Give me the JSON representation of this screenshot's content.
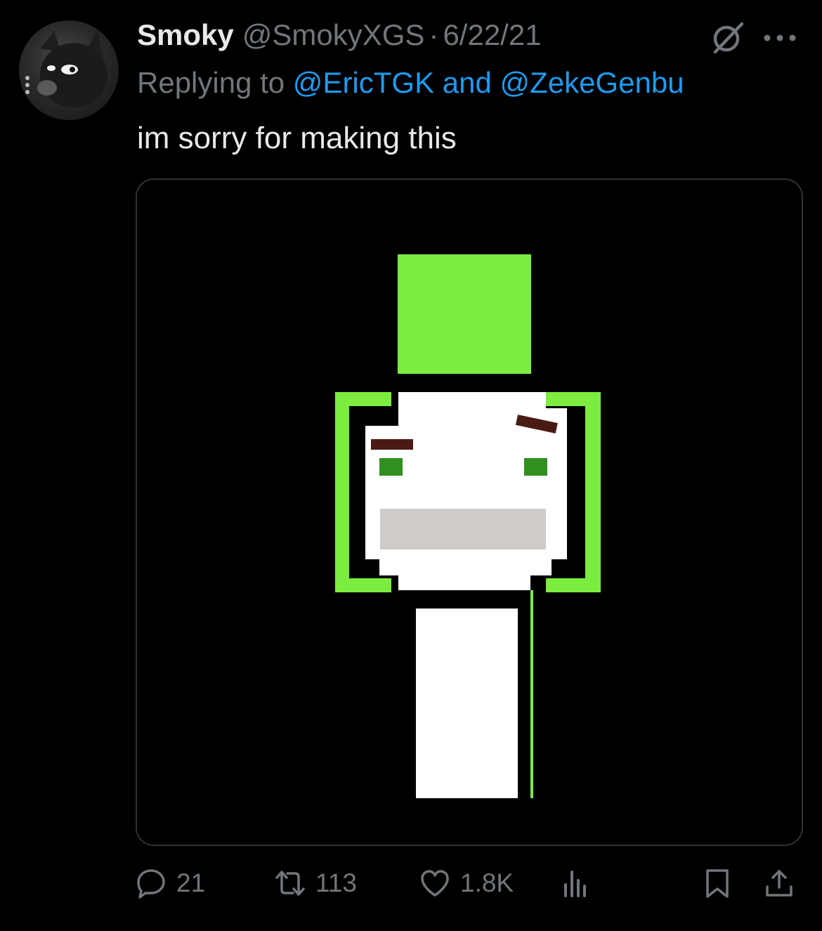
{
  "tweet": {
    "display_name": "Smoky",
    "handle": "@SmokyXGS",
    "separator": "·",
    "date": "6/22/21",
    "reply_prefix": "Replying to",
    "reply_mention_1": "@EricTGK",
    "reply_joiner": "and",
    "reply_mention_2": "@ZekeGenbu",
    "text": "im sorry for making this"
  },
  "actions": {
    "replies": "21",
    "retweets": "113",
    "likes": "1.8K"
  },
  "colors": {
    "background": "#000000",
    "primary_text": "#e7e9ea",
    "secondary_text": "#71767b",
    "link": "#1d9bf0",
    "border": "#2f3336",
    "image_green": "#7cec3f"
  },
  "icons": {
    "header": [
      "grok-icon",
      "more-icon"
    ],
    "actions": [
      "reply-icon",
      "retweet-icon",
      "like-icon",
      "views-icon",
      "bookmark-icon",
      "share-icon"
    ]
  }
}
